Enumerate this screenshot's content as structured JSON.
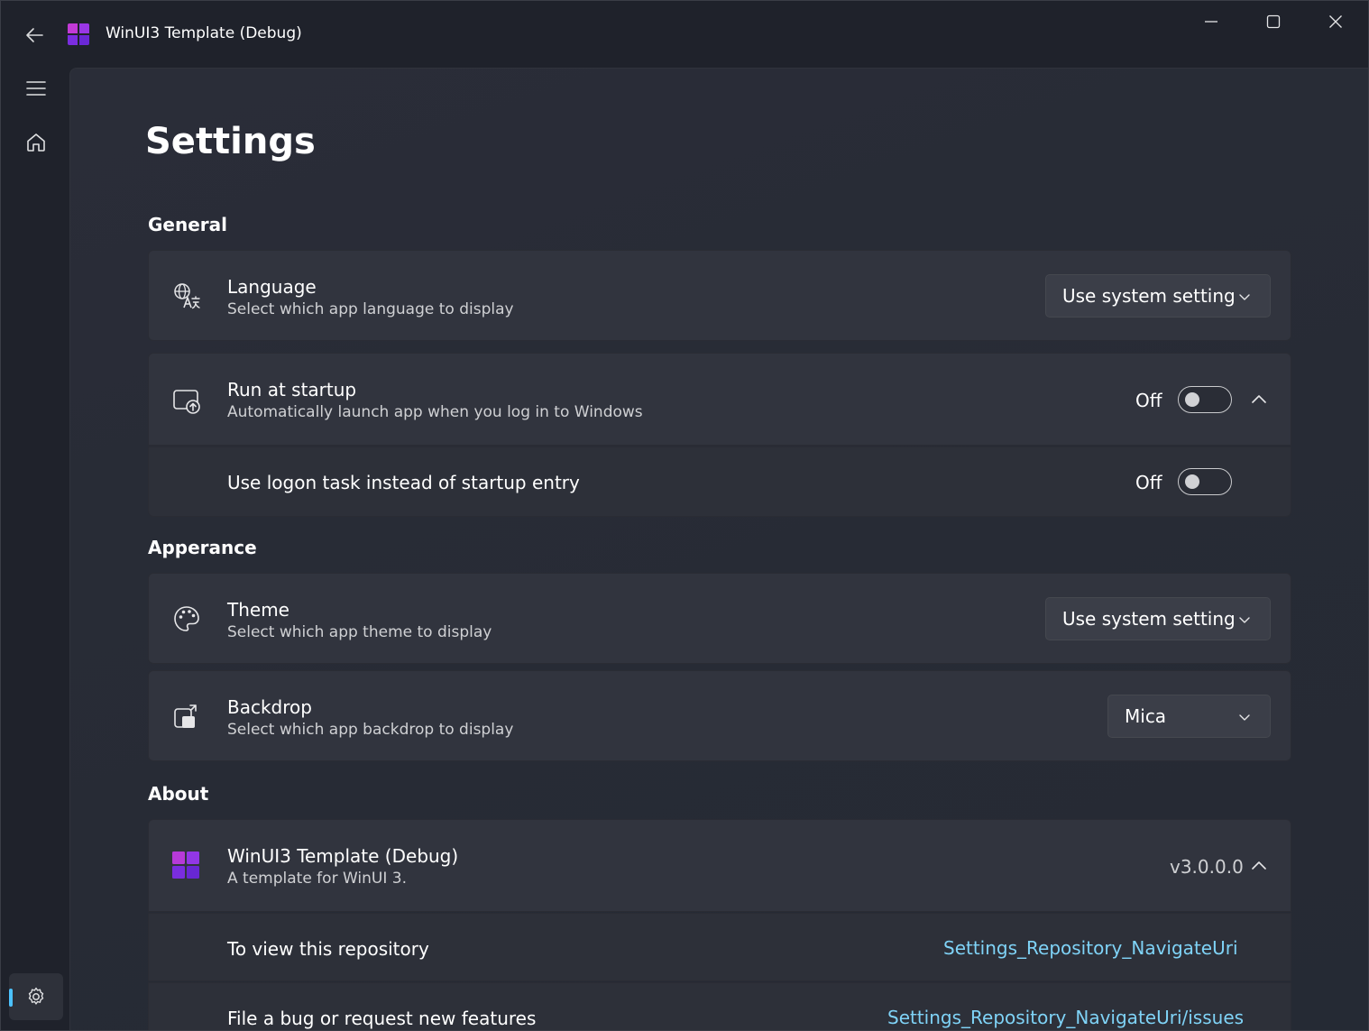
{
  "titlebar": {
    "title": "WinUI3 Template (Debug)"
  },
  "page": {
    "title": "Settings"
  },
  "sections": {
    "general": "General",
    "appearance": "Apperance",
    "about": "About"
  },
  "language": {
    "title": "Language",
    "description": "Select which app language to display",
    "value": "Use system setting"
  },
  "startup": {
    "title": "Run at startup",
    "description": "Automatically launch app when you log in to Windows",
    "state": "Off",
    "logon_task_title": "Use logon task instead of startup entry",
    "logon_task_state": "Off"
  },
  "theme": {
    "title": "Theme",
    "description": "Select which app theme to display",
    "value": "Use system setting"
  },
  "backdrop": {
    "title": "Backdrop",
    "description": "Select which app backdrop to display",
    "value": "Mica"
  },
  "about": {
    "app_title": "WinUI3 Template (Debug)",
    "app_description": "A template for WinUI 3.",
    "version": "v3.0.0.0",
    "repo_label": "To view this repository",
    "repo_link": "Settings_Repository_NavigateUri",
    "issues_label": "File a bug or request new features",
    "issues_link": "Settings_Repository_NavigateUri/issues"
  },
  "colors": {
    "accent": "#4cc2ff",
    "link": "#7fd3f7",
    "card_background": "#31343e",
    "window_background": "#1f222b"
  },
  "icons": {
    "back": "back-arrow-icon",
    "menu": "hamburger-menu-icon",
    "home": "home-icon",
    "settings": "gear-icon",
    "minimize": "minimize-icon",
    "maximize": "maximize-icon",
    "close": "close-icon",
    "language": "translate-icon",
    "startup": "startup-app-icon",
    "theme": "palette-icon",
    "backdrop": "backdrop-icon",
    "app": "app-logo-icon"
  }
}
